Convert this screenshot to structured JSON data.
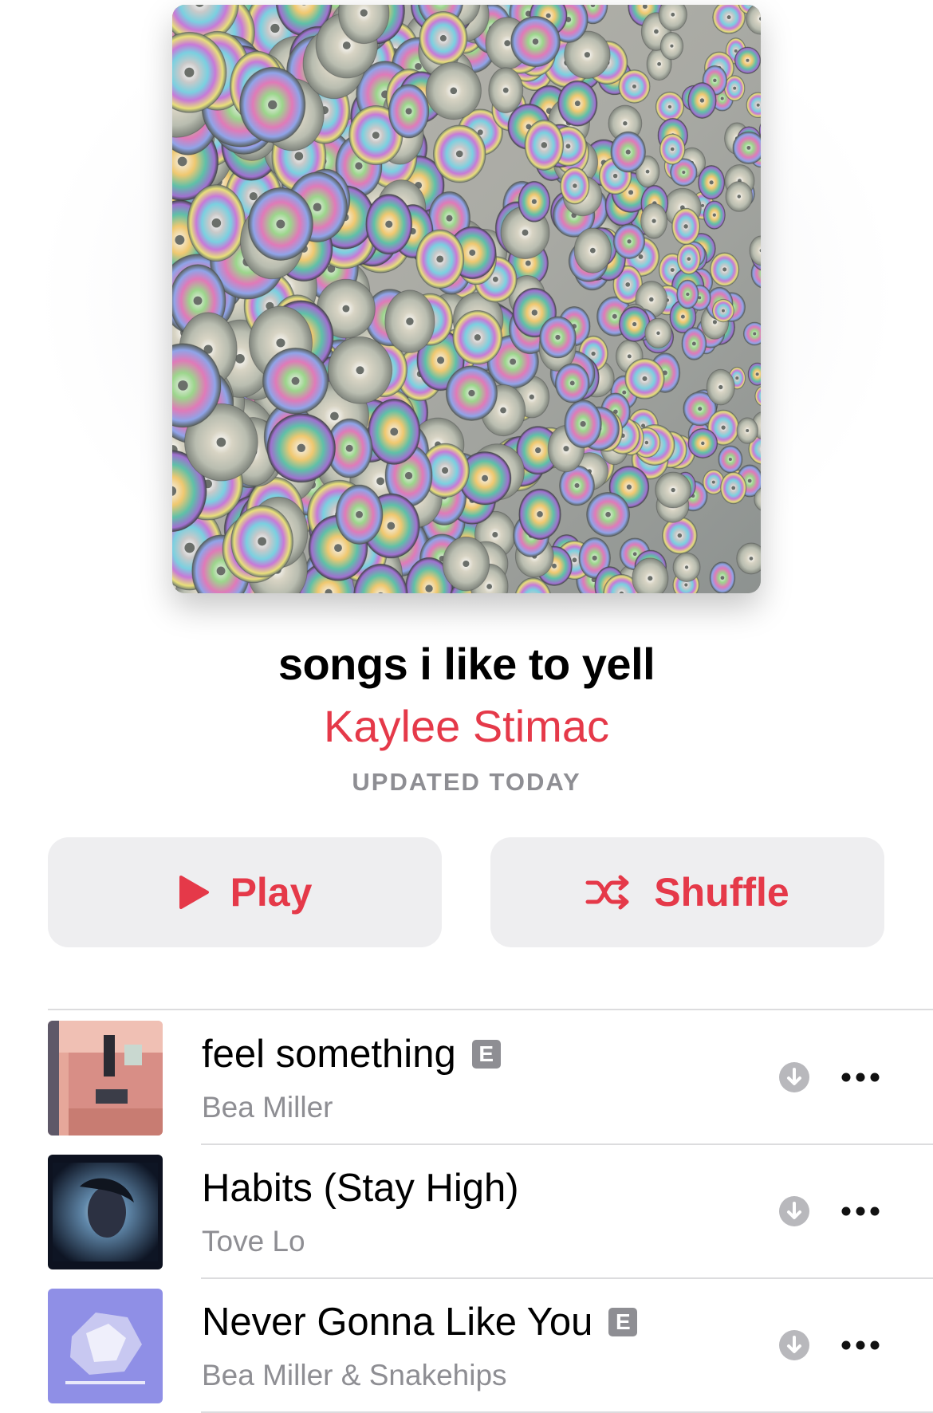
{
  "playlist": {
    "title": "songs i like to yell",
    "curator": "Kaylee Stimac",
    "updated": "UPDATED TODAY",
    "artwork_icon": "cd-wall-artwork"
  },
  "actions": {
    "play_label": "Play",
    "shuffle_label": "Shuffle"
  },
  "colors": {
    "accent": "#e53949",
    "secondary_text": "#8e8e93",
    "button_bg": "#eeeef0"
  },
  "tracks": [
    {
      "title": "feel something",
      "artist": "Bea Miller",
      "explicit": true,
      "explicit_label": "E"
    },
    {
      "title": "Habits (Stay High)",
      "artist": "Tove Lo",
      "explicit": false,
      "explicit_label": ""
    },
    {
      "title": "Never Gonna Like You",
      "artist": "Bea Miller & Snakehips",
      "explicit": true,
      "explicit_label": "E"
    }
  ]
}
